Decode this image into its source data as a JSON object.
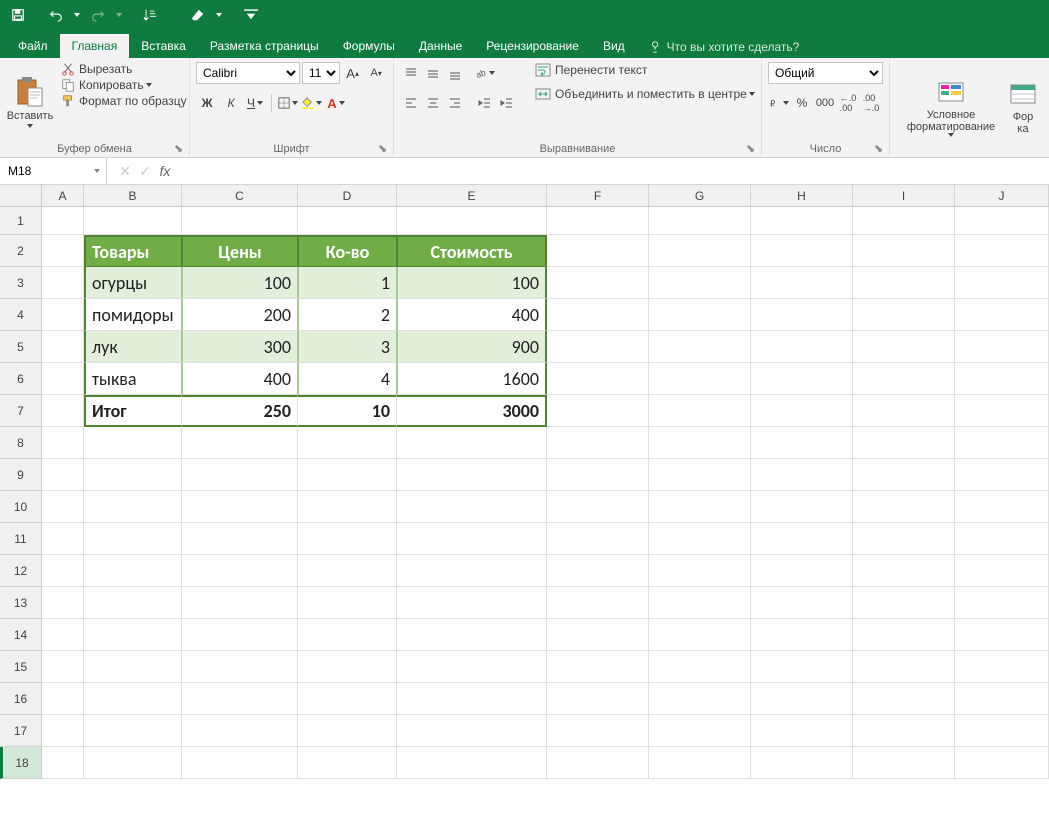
{
  "quick_access": {
    "save": "save",
    "undo": "undo",
    "redo": "redo"
  },
  "tabs": {
    "file": "Файл",
    "home": "Главная",
    "insert": "Вставка",
    "layout": "Разметка страницы",
    "formulas": "Формулы",
    "data": "Данные",
    "review": "Рецензирование",
    "view": "Вид",
    "tell_me": "Что вы хотите сделать?"
  },
  "ribbon": {
    "paste": "Вставить",
    "cut": "Вырезать",
    "copy": "Копировать",
    "format_painter": "Формат по образцу",
    "clipboard_label": "Буфер обмена",
    "font_name": "Calibri",
    "font_size": "11",
    "font_label": "Шрифт",
    "alignment_label": "Выравнивание",
    "wrap_text": "Перенести текст",
    "merge_center": "Объединить и поместить в центре",
    "number_format": "Общий",
    "number_label": "Число",
    "cond_format": "Условное форматирование",
    "format_as": "Фор",
    "format_as2": "ка"
  },
  "formula_bar": {
    "name_box": "M18",
    "formula": ""
  },
  "columns": [
    "A",
    "B",
    "C",
    "D",
    "E",
    "F",
    "G",
    "H",
    "I",
    "J"
  ],
  "rows": [
    "1",
    "2",
    "3",
    "4",
    "5",
    "6",
    "7",
    "8",
    "9",
    "10",
    "11",
    "12",
    "13",
    "14",
    "15",
    "16",
    "17",
    "18"
  ],
  "table": {
    "headers": [
      "Товары",
      "Цены",
      "Ко-во",
      "Стоимость"
    ],
    "data": [
      [
        "огурцы",
        "100",
        "1",
        "100"
      ],
      [
        "помидоры",
        "200",
        "2",
        "400"
      ],
      [
        "лук",
        "300",
        "3",
        "900"
      ],
      [
        "тыква",
        "400",
        "4",
        "1600"
      ]
    ],
    "total": [
      "Итог",
      "250",
      "10",
      "3000"
    ]
  },
  "chart_data": {
    "type": "table",
    "title": "Товары",
    "columns": [
      "Товары",
      "Цены",
      "Ко-во",
      "Стоимость"
    ],
    "rows": [
      {
        "Товары": "огурцы",
        "Цены": 100,
        "Ко-во": 1,
        "Стоимость": 100
      },
      {
        "Товары": "помидоры",
        "Цены": 200,
        "Ко-во": 2,
        "Стоимость": 400
      },
      {
        "Товары": "лук",
        "Цены": 300,
        "Ко-во": 3,
        "Стоимость": 900
      },
      {
        "Товары": "тыква",
        "Цены": 400,
        "Ко-во": 4,
        "Стоимость": 1600
      }
    ],
    "totals": {
      "Итог": {
        "Цены": 250,
        "Ко-во": 10,
        "Стоимость": 3000
      }
    }
  }
}
